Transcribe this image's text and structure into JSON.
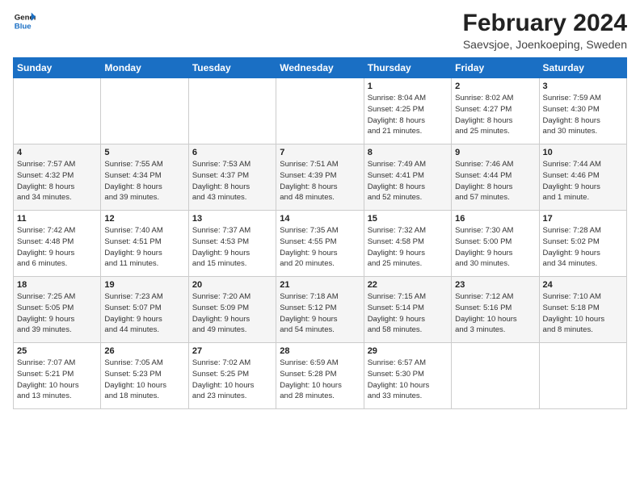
{
  "header": {
    "logo_line1": "General",
    "logo_line2": "Blue",
    "title": "February 2024",
    "subtitle": "Saevsjoe, Joenkoeping, Sweden"
  },
  "calendar": {
    "headers": [
      "Sunday",
      "Monday",
      "Tuesday",
      "Wednesday",
      "Thursday",
      "Friday",
      "Saturday"
    ],
    "weeks": [
      [
        {
          "day": "",
          "info": ""
        },
        {
          "day": "",
          "info": ""
        },
        {
          "day": "",
          "info": ""
        },
        {
          "day": "",
          "info": ""
        },
        {
          "day": "1",
          "info": "Sunrise: 8:04 AM\nSunset: 4:25 PM\nDaylight: 8 hours\nand 21 minutes."
        },
        {
          "day": "2",
          "info": "Sunrise: 8:02 AM\nSunset: 4:27 PM\nDaylight: 8 hours\nand 25 minutes."
        },
        {
          "day": "3",
          "info": "Sunrise: 7:59 AM\nSunset: 4:30 PM\nDaylight: 8 hours\nand 30 minutes."
        }
      ],
      [
        {
          "day": "4",
          "info": "Sunrise: 7:57 AM\nSunset: 4:32 PM\nDaylight: 8 hours\nand 34 minutes."
        },
        {
          "day": "5",
          "info": "Sunrise: 7:55 AM\nSunset: 4:34 PM\nDaylight: 8 hours\nand 39 minutes."
        },
        {
          "day": "6",
          "info": "Sunrise: 7:53 AM\nSunset: 4:37 PM\nDaylight: 8 hours\nand 43 minutes."
        },
        {
          "day": "7",
          "info": "Sunrise: 7:51 AM\nSunset: 4:39 PM\nDaylight: 8 hours\nand 48 minutes."
        },
        {
          "day": "8",
          "info": "Sunrise: 7:49 AM\nSunset: 4:41 PM\nDaylight: 8 hours\nand 52 minutes."
        },
        {
          "day": "9",
          "info": "Sunrise: 7:46 AM\nSunset: 4:44 PM\nDaylight: 8 hours\nand 57 minutes."
        },
        {
          "day": "10",
          "info": "Sunrise: 7:44 AM\nSunset: 4:46 PM\nDaylight: 9 hours\nand 1 minute."
        }
      ],
      [
        {
          "day": "11",
          "info": "Sunrise: 7:42 AM\nSunset: 4:48 PM\nDaylight: 9 hours\nand 6 minutes."
        },
        {
          "day": "12",
          "info": "Sunrise: 7:40 AM\nSunset: 4:51 PM\nDaylight: 9 hours\nand 11 minutes."
        },
        {
          "day": "13",
          "info": "Sunrise: 7:37 AM\nSunset: 4:53 PM\nDaylight: 9 hours\nand 15 minutes."
        },
        {
          "day": "14",
          "info": "Sunrise: 7:35 AM\nSunset: 4:55 PM\nDaylight: 9 hours\nand 20 minutes."
        },
        {
          "day": "15",
          "info": "Sunrise: 7:32 AM\nSunset: 4:58 PM\nDaylight: 9 hours\nand 25 minutes."
        },
        {
          "day": "16",
          "info": "Sunrise: 7:30 AM\nSunset: 5:00 PM\nDaylight: 9 hours\nand 30 minutes."
        },
        {
          "day": "17",
          "info": "Sunrise: 7:28 AM\nSunset: 5:02 PM\nDaylight: 9 hours\nand 34 minutes."
        }
      ],
      [
        {
          "day": "18",
          "info": "Sunrise: 7:25 AM\nSunset: 5:05 PM\nDaylight: 9 hours\nand 39 minutes."
        },
        {
          "day": "19",
          "info": "Sunrise: 7:23 AM\nSunset: 5:07 PM\nDaylight: 9 hours\nand 44 minutes."
        },
        {
          "day": "20",
          "info": "Sunrise: 7:20 AM\nSunset: 5:09 PM\nDaylight: 9 hours\nand 49 minutes."
        },
        {
          "day": "21",
          "info": "Sunrise: 7:18 AM\nSunset: 5:12 PM\nDaylight: 9 hours\nand 54 minutes."
        },
        {
          "day": "22",
          "info": "Sunrise: 7:15 AM\nSunset: 5:14 PM\nDaylight: 9 hours\nand 58 minutes."
        },
        {
          "day": "23",
          "info": "Sunrise: 7:12 AM\nSunset: 5:16 PM\nDaylight: 10 hours\nand 3 minutes."
        },
        {
          "day": "24",
          "info": "Sunrise: 7:10 AM\nSunset: 5:18 PM\nDaylight: 10 hours\nand 8 minutes."
        }
      ],
      [
        {
          "day": "25",
          "info": "Sunrise: 7:07 AM\nSunset: 5:21 PM\nDaylight: 10 hours\nand 13 minutes."
        },
        {
          "day": "26",
          "info": "Sunrise: 7:05 AM\nSunset: 5:23 PM\nDaylight: 10 hours\nand 18 minutes."
        },
        {
          "day": "27",
          "info": "Sunrise: 7:02 AM\nSunset: 5:25 PM\nDaylight: 10 hours\nand 23 minutes."
        },
        {
          "day": "28",
          "info": "Sunrise: 6:59 AM\nSunset: 5:28 PM\nDaylight: 10 hours\nand 28 minutes."
        },
        {
          "day": "29",
          "info": "Sunrise: 6:57 AM\nSunset: 5:30 PM\nDaylight: 10 hours\nand 33 minutes."
        },
        {
          "day": "",
          "info": ""
        },
        {
          "day": "",
          "info": ""
        }
      ]
    ]
  }
}
